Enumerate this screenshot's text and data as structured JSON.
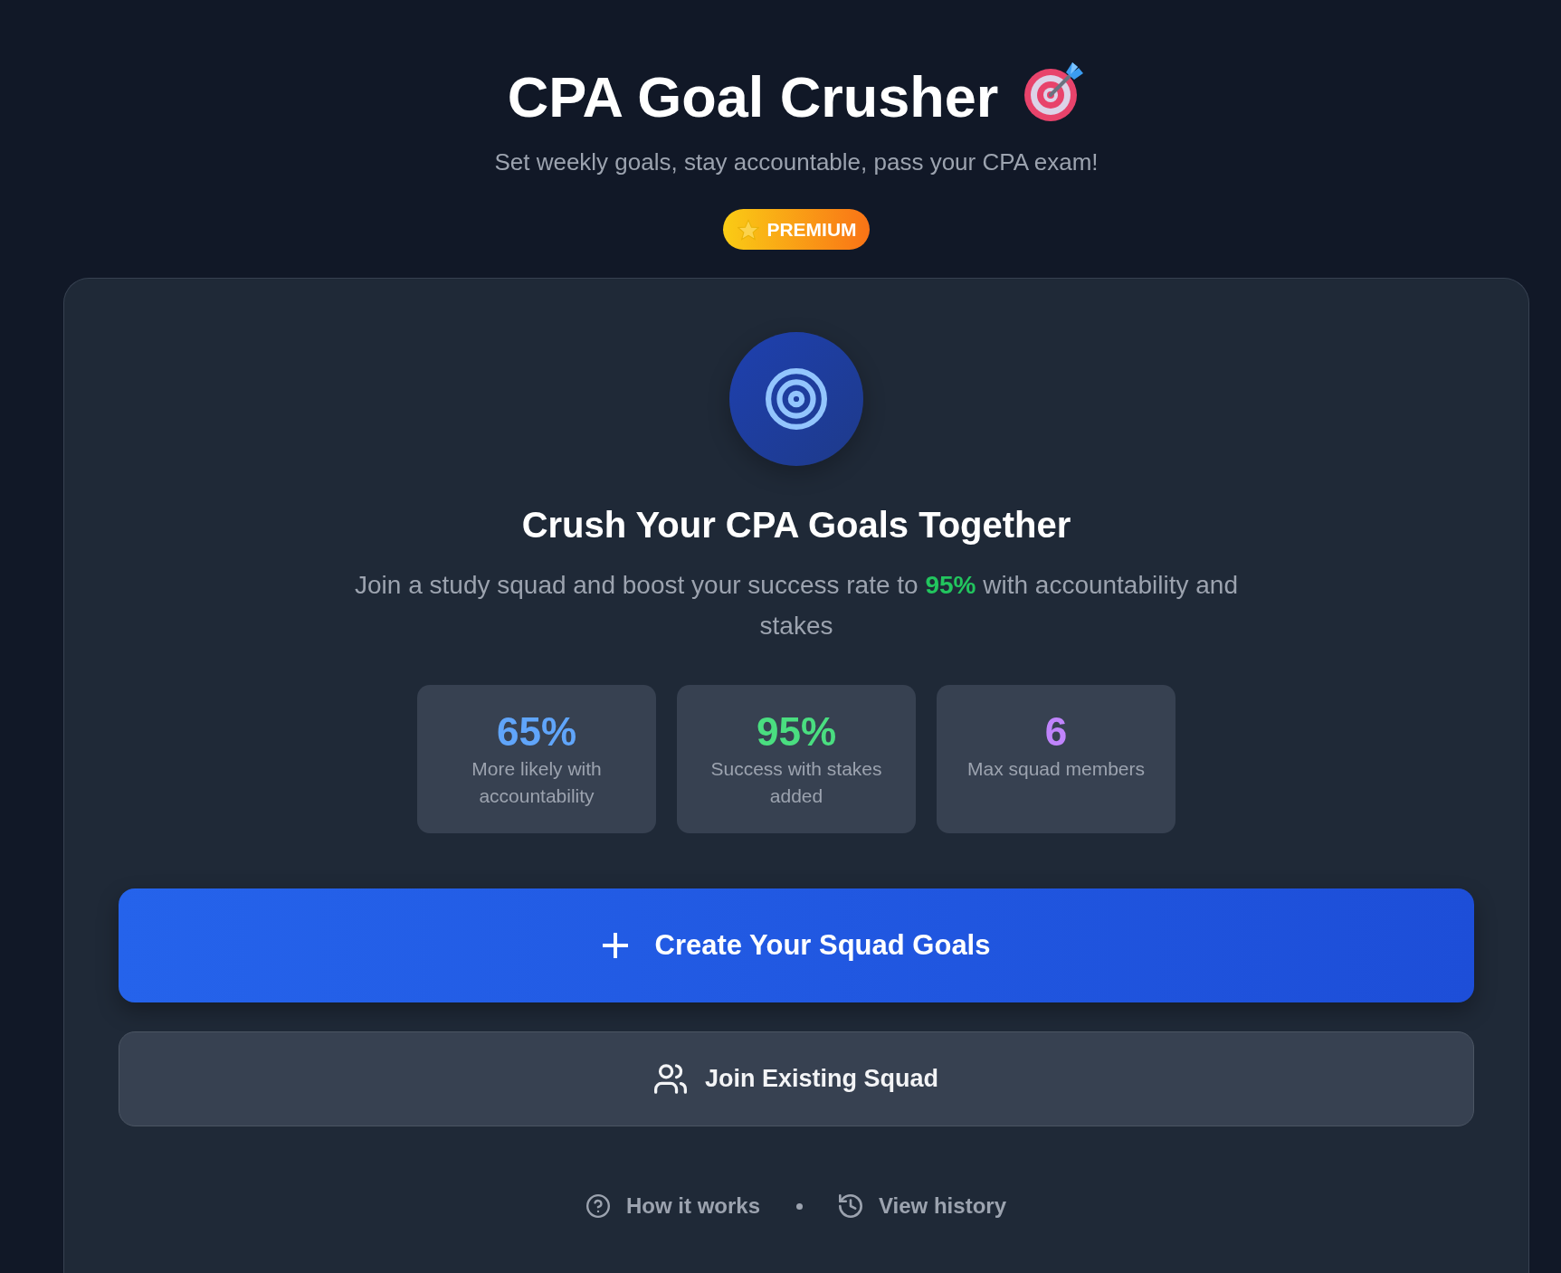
{
  "header": {
    "title": "CPA Goal Crusher",
    "subtitle": "Set weekly goals, stay accountable, pass your CPA exam!",
    "badge": "PREMIUM"
  },
  "hero": {
    "heading": "Crush Your CPA Goals Together",
    "description": "Join a study squad and boost your success rate to **95%** with accountability and stakes"
  },
  "stats": [
    {
      "value": "65%",
      "label": "More likely with accountability",
      "color": "#60a5fa"
    },
    {
      "value": "95%",
      "label": "Success with stakes added",
      "color": "#4ade80"
    },
    {
      "value": "6",
      "label": "Max squad members",
      "color": "#c084fc"
    }
  ],
  "actions": [
    {
      "kind": "primary",
      "label": "Create Your Squad Goals"
    },
    {
      "kind": "secondary",
      "label": "Join Existing Squad"
    }
  ],
  "links": [
    {
      "label": "How it works"
    },
    {
      "label": "View history"
    }
  ]
}
